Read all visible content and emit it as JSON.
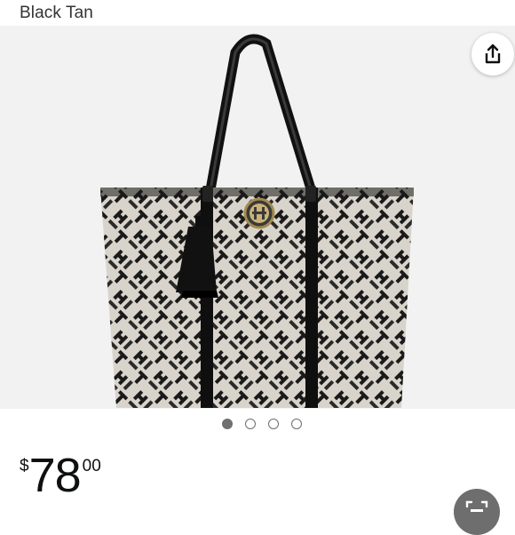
{
  "product": {
    "variant_label": "Black Tan",
    "price_symbol": "$",
    "price_whole": "78",
    "price_fraction": "00"
  },
  "gallery": {
    "image_count": 4,
    "active_index": 0,
    "background": "#f2f2f2"
  },
  "icons": {
    "share": "share-icon",
    "scan": "scan-icon"
  }
}
